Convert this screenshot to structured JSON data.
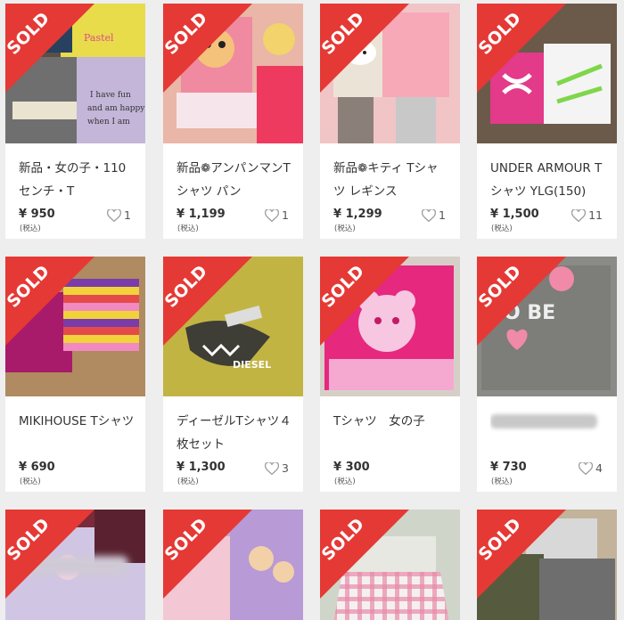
{
  "sold_label": "SOLD",
  "colors": {
    "sold_banner": "#e53935",
    "heart_outline": "#9e9e9e",
    "background": "#eeeeee"
  },
  "items": [
    {
      "title": "新品・女の子・110センチ・T",
      "price": "¥ 950",
      "tax": "(税込)",
      "likes": "1",
      "image": "girls-tshirts-set"
    },
    {
      "title": "新品❁アンパンマンTシャツ パン",
      "price": "¥ 1,199",
      "tax": "(税込)",
      "likes": "1",
      "image": "anpanman-pink-shirts"
    },
    {
      "title": "新品❁キティ Tシャツ レギンス",
      "price": "¥ 1,299",
      "tax": "(税込)",
      "likes": "1",
      "image": "hello-kitty-shirts"
    },
    {
      "title": "UNDER ARMOUR Tシャツ YLG(150)",
      "price": "¥ 1,500",
      "tax": "(税込)",
      "likes": "11",
      "image": "under-armour-shirts"
    },
    {
      "title": "MIKIHOUSE Tシャツ",
      "price": "¥ 690",
      "tax": "(税込)",
      "likes": "",
      "image": "mikihouse-striped-shirt"
    },
    {
      "title": "ディーゼルTシャツ４枚セット",
      "price": "¥ 1,300",
      "tax": "(税込)",
      "likes": "3",
      "image": "diesel-shark-shirt"
    },
    {
      "title": "Tシャツ　女の子",
      "price": "¥ 300",
      "tax": "(税込)",
      "likes": "",
      "image": "pink-bear-shirt"
    },
    {
      "title": "",
      "price": "¥ 730",
      "tax": "(税込)",
      "likes": "4",
      "image": "tobe-gray-shirt"
    },
    {
      "title": "",
      "price": "",
      "tax": "",
      "likes": "",
      "image": "girls-princess-shirts"
    },
    {
      "title": "",
      "price": "",
      "tax": "",
      "likes": "",
      "image": "precure-purple-shirts"
    },
    {
      "title": "",
      "price": "",
      "tax": "",
      "likes": "",
      "image": "plaid-dress"
    },
    {
      "title": "",
      "price": "",
      "tax": "",
      "likes": "",
      "image": "gray-shirts-set"
    }
  ]
}
